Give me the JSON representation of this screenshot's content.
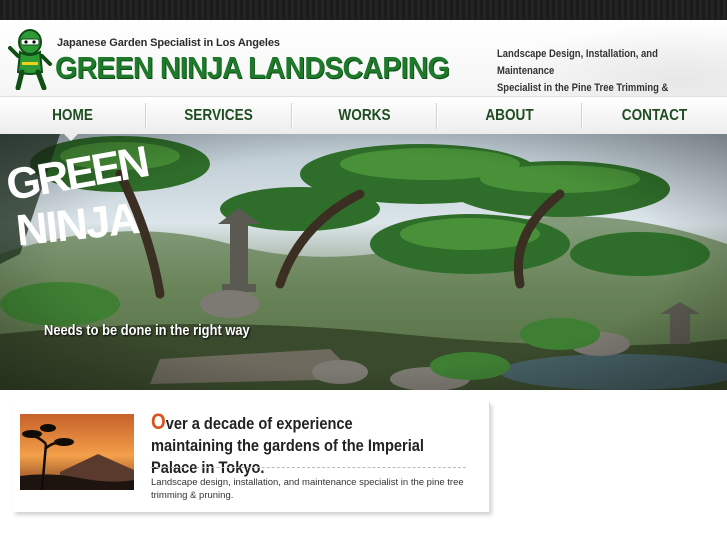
{
  "header": {
    "tagline": "Japanese Garden Specialist in Los Angeles",
    "brand": "GREEN NINJA LANDSCAPING",
    "spec_line1": "Landscape Design, Installation, and Maintenance",
    "spec_line2": "Specialist in the Pine Tree Trimming & Pruning"
  },
  "nav": {
    "items": [
      {
        "label": "HOME"
      },
      {
        "label": "SERVICES"
      },
      {
        "label": "WORKS"
      },
      {
        "label": "ABOUT"
      },
      {
        "label": "CONTACT"
      }
    ],
    "active": "HOME"
  },
  "hero": {
    "logo_text": "GREEN NINJA",
    "subtitle": "Needs to be done in the right way"
  },
  "content": {
    "headline_initial": "O",
    "headline_rest": "ver a decade of experience maintaining the gardens of the Imperial Palace in Tokyo.",
    "description": "Landscape design, installation, and maintenance specialist in the pine tree trimming & pruning."
  },
  "colors": {
    "brand_green": "#1e7a2a",
    "nav_text": "#1f4d22",
    "accent_orange": "#d9541e",
    "top_strip": "#1b1b1b"
  }
}
